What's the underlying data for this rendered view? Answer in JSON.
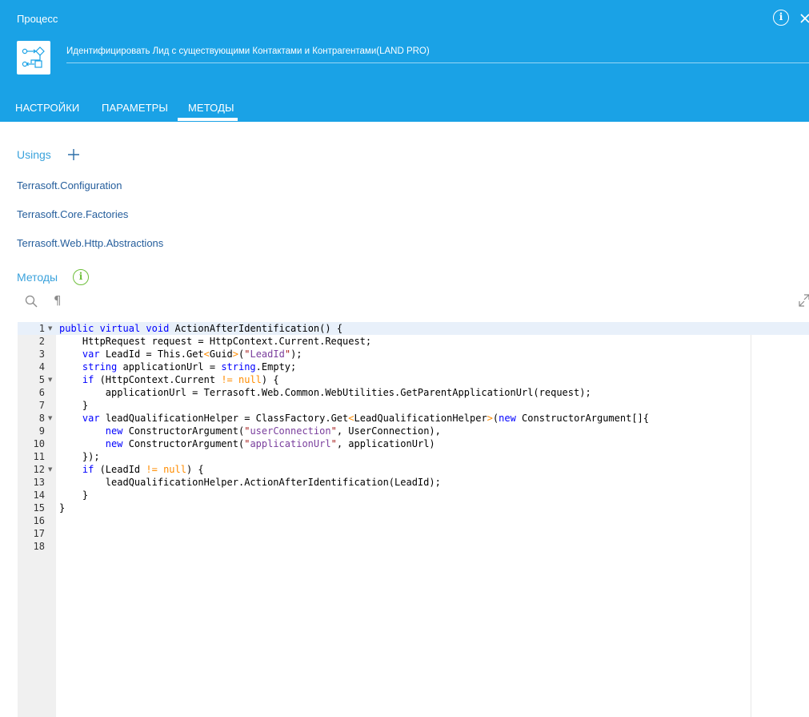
{
  "header": {
    "title": "Процесс",
    "process_name": "Идентифицировать Лид с существующими Контактами и Контрагентами(LAND PRO)",
    "info_icon": "info-icon",
    "close_icon": "close-icon",
    "process_icon": "process-flow-icon",
    "bg_color": "#1aa2e6"
  },
  "tabs": [
    {
      "label": "НАСТРОЙКИ",
      "active": false
    },
    {
      "label": "ПАРАМЕТРЫ",
      "active": false
    },
    {
      "label": "МЕТОДЫ",
      "active": true
    }
  ],
  "usings": {
    "title": "Usings",
    "add_icon": "plus-icon",
    "items": [
      "Terrasoft.Configuration",
      "Terrasoft.Core.Factories",
      "Terrasoft.Web.Http.Abstractions"
    ]
  },
  "methods": {
    "title": "Методы",
    "info_icon": "info-icon",
    "toolbar": {
      "search_icon": "search-icon",
      "pilcrow": "¶",
      "expand_icon": "expand-icon"
    }
  },
  "editor": {
    "line_numbers": [
      "1",
      "2",
      "3",
      "4",
      "5",
      "6",
      "7",
      "8",
      "9",
      "10",
      "11",
      "12",
      "13",
      "14",
      "15",
      "16",
      "17",
      "18"
    ],
    "foldable_lines": [
      1,
      5,
      8,
      12
    ],
    "active_line": 1,
    "lines": [
      "public virtual void ActionAfterIdentification() {",
      "    HttpRequest request = HttpContext.Current.Request;",
      "    var LeadId = This.Get<Guid>(\"LeadId\");",
      "    string applicationUrl = string.Empty;",
      "    if (HttpContext.Current != null) {",
      "        applicationUrl = Terrasoft.Web.Common.WebUtilities.GetParentApplicationUrl(request);",
      "    }",
      "    var leadQualificationHelper = ClassFactory.Get<LeadQualificationHelper>(new ConstructorArgument[]{",
      "        new ConstructorArgument(\"userConnection\", UserConnection),",
      "        new ConstructorArgument(\"applicationUrl\", applicationUrl)",
      "    });",
      "    if (LeadId != null) {",
      "        leadQualificationHelper.ActionAfterIdentification(LeadId);",
      "    }",
      "}",
      "",
      "",
      ""
    ]
  }
}
